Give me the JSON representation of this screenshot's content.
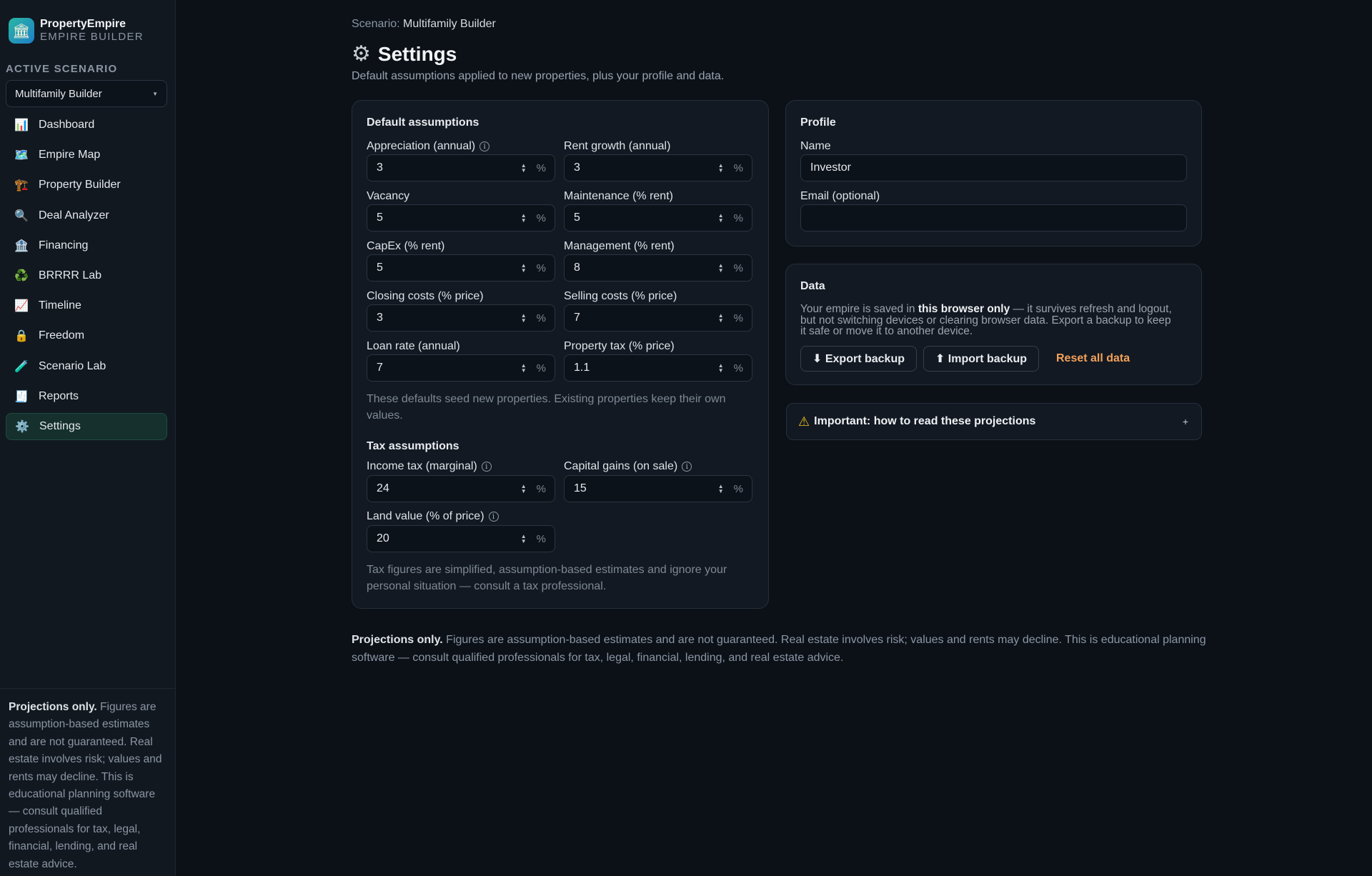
{
  "brand": {
    "name": "PropertyEmpire",
    "subtitle": "EMPIRE BUILDER",
    "logo_icon": "bank-icon"
  },
  "sidebar": {
    "active_scenario_label": "ACTIVE SCENARIO",
    "scenario_value": "Multifamily Builder",
    "items": [
      {
        "label": "Dashboard",
        "icon": "📊"
      },
      {
        "label": "Empire Map",
        "icon": "🗺️"
      },
      {
        "label": "Property Builder",
        "icon": "🏗️"
      },
      {
        "label": "Deal Analyzer",
        "icon": "🔍"
      },
      {
        "label": "Financing",
        "icon": "🏦"
      },
      {
        "label": "BRRRR Lab",
        "icon": "♻️"
      },
      {
        "label": "Timeline",
        "icon": "📈"
      },
      {
        "label": "Freedom",
        "icon": "🔒"
      },
      {
        "label": "Scenario Lab",
        "icon": "🧪"
      },
      {
        "label": "Reports",
        "icon": "🧾"
      },
      {
        "label": "Settings",
        "icon": "⚙️"
      }
    ],
    "active_item": "Settings",
    "disclaimer_bold": "Projections only.",
    "disclaimer_text": " Figures are assumption-based estimates and are not guaranteed. Real estate involves risk; values and rents may decline. This is educational planning software — consult qualified professionals for tax, legal, financial, lending, and real estate advice."
  },
  "header": {
    "crumb_label": "Scenario:",
    "crumb_value": "Multifamily Builder",
    "title": "Settings",
    "subtitle": "Default assumptions applied to new properties, plus your profile and data."
  },
  "defaults": {
    "title": "Default assumptions",
    "fields": {
      "appreciation": {
        "label": "Appreciation (annual)",
        "value": "3",
        "unit": "%"
      },
      "rent_growth": {
        "label": "Rent growth (annual)",
        "value": "3",
        "unit": "%"
      },
      "vacancy": {
        "label": "Vacancy",
        "value": "5",
        "unit": "%"
      },
      "maintenance": {
        "label": "Maintenance (% rent)",
        "value": "5",
        "unit": "%"
      },
      "capex": {
        "label": "CapEx (% rent)",
        "value": "5",
        "unit": "%"
      },
      "management": {
        "label": "Management (% rent)",
        "value": "8",
        "unit": "%"
      },
      "closing": {
        "label": "Closing costs (% price)",
        "value": "3",
        "unit": "%"
      },
      "selling": {
        "label": "Selling costs (% price)",
        "value": "7",
        "unit": "%"
      },
      "loan_rate": {
        "label": "Loan rate (annual)",
        "value": "7",
        "unit": "%"
      },
      "property_tax": {
        "label": "Property tax (% price)",
        "value": "1.1",
        "unit": "%"
      }
    },
    "hint": "These defaults seed new properties. Existing properties keep their own values."
  },
  "tax": {
    "title": "Tax assumptions",
    "fields": {
      "income_tax": {
        "label": "Income tax (marginal)",
        "value": "24",
        "unit": "%"
      },
      "capital_gains": {
        "label": "Capital gains (on sale)",
        "value": "15",
        "unit": "%"
      },
      "land_value": {
        "label": "Land value (% of price)",
        "value": "20",
        "unit": "%"
      }
    },
    "hint": "Tax figures are simplified, assumption-based estimates and ignore your personal situation — consult a tax professional."
  },
  "profile": {
    "title": "Profile",
    "name_label": "Name",
    "name_value": "Investor",
    "email_label": "Email (optional)",
    "email_value": ""
  },
  "data_card": {
    "title": "Data",
    "text_pre": "Your empire is saved in ",
    "text_bold": "this browser only",
    "text_post": " — it survives refresh and logout, but not switching devices or clearing browser data. Export a backup to keep it safe or move it to another device.",
    "export_label": "⬇ Export backup",
    "import_label": "⬆ Import backup",
    "reset_label": "Reset all data"
  },
  "accordion": {
    "label": "Important: how to read these projections",
    "toggle": "+"
  },
  "footer": {
    "bold": "Projections only.",
    "text": " Figures are assumption-based estimates and are not guaranteed. Real estate involves risk; values and rents may decline. This is educational planning software — consult qualified professionals for tax, legal, financial, lending, and real estate advice."
  },
  "colors": {
    "accent": "#29b6a4",
    "danger": "#f3a15a",
    "warning": "#f2c025",
    "background": "#0c1118"
  }
}
